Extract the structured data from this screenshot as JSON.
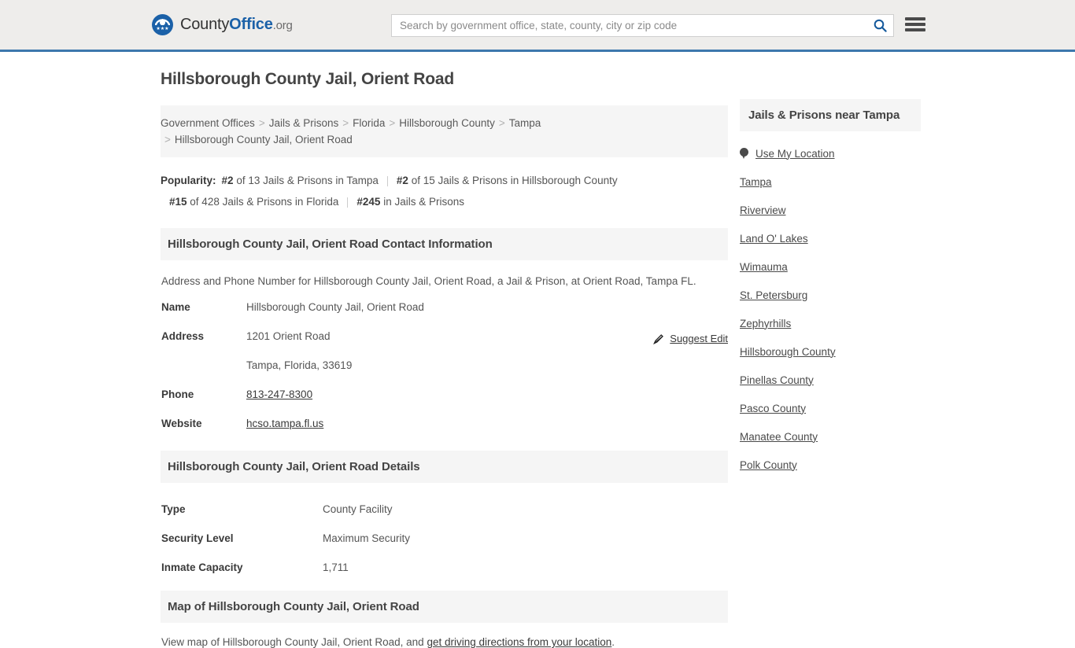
{
  "header": {
    "brand": {
      "county": "County",
      "office": "Office",
      "org": ".org",
      "stars": "★★★"
    },
    "search": {
      "placeholder": "Search by government office, state, county, city or zip code",
      "value": "",
      "search_icon": "search-icon"
    },
    "menu_icon": "hamburger-menu-icon"
  },
  "main": {
    "title": "Hillsborough County Jail, Orient Road",
    "breadcrumb": {
      "separator": ">",
      "items": [
        "Government Offices",
        "Jails & Prisons",
        "Florida",
        "Hillsborough County",
        "Tampa"
      ],
      "current": "Hillsborough County Jail, Orient Road"
    },
    "popularity": {
      "label": "Popularity:",
      "items": [
        {
          "rank": "#2",
          "text": "of 13 Jails & Prisons in Tampa"
        },
        {
          "rank": "#2",
          "text": "of 15 Jails & Prisons in Hillsborough County"
        },
        {
          "rank": "#15",
          "text": "of 428 Jails & Prisons in Florida"
        },
        {
          "rank": "#245",
          "text": "in Jails & Prisons"
        }
      ]
    },
    "contact": {
      "heading": "Hillsborough County Jail, Orient Road Contact Information",
      "subtitle": "Address and Phone Number for Hillsborough County Jail, Orient Road, a Jail & Prison, at Orient Road, Tampa FL.",
      "suggest_edit": "Suggest Edit",
      "suggest_edit_icon": "edit-pencil-icon",
      "rows": [
        {
          "key": "Name",
          "value": "Hillsborough County Jail, Orient Road",
          "link": false
        },
        {
          "key": "Address",
          "value": "1201 Orient Road",
          "link": false
        },
        {
          "key": "",
          "value": "Tampa, Florida, 33619",
          "link": false
        },
        {
          "key": "Phone",
          "value": "813-247-8300",
          "link": true
        },
        {
          "key": "Website",
          "value": "hcso.tampa.fl.us",
          "link": true
        }
      ]
    },
    "details": {
      "heading": "Hillsborough County Jail, Orient Road Details",
      "rows": [
        {
          "key": "Type",
          "value": "County Facility"
        },
        {
          "key": "Security Level",
          "value": "Maximum Security"
        },
        {
          "key": "Inmate Capacity",
          "value": "1,711"
        }
      ]
    },
    "map": {
      "heading": "Map of Hillsborough County Jail, Orient Road",
      "note_prefix": "View map of Hillsborough County Jail, Orient Road, and ",
      "note_link": "get driving directions from your location",
      "note_suffix": "."
    }
  },
  "sidebar": {
    "heading": "Jails & Prisons near Tampa",
    "use_my_location": "Use My Location",
    "location_icon": "map-pin-icon",
    "links": [
      "Tampa",
      "Riverview",
      "Land O' Lakes",
      "Wimauma",
      "St. Petersburg",
      "Zephyrhills",
      "Hillsborough County",
      "Pinellas County",
      "Pasco County",
      "Manatee County",
      "Polk County"
    ]
  },
  "colors": {
    "brand_blue": "#1b61a8",
    "header_bg": "#eeedeb",
    "header_border": "#3d78ad",
    "panel_bg": "#f5f5f5"
  }
}
